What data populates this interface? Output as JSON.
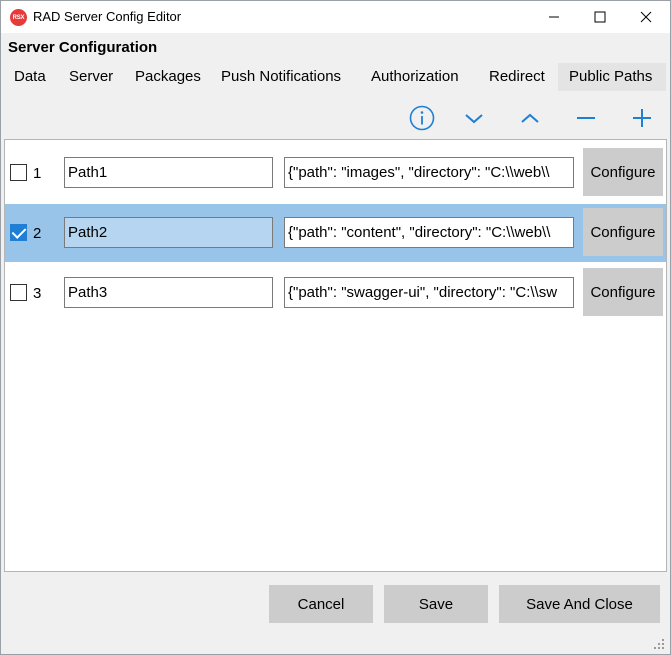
{
  "window": {
    "title": "RAD Server Config Editor",
    "icon_label": "RSX"
  },
  "section_title": "Server Configuration",
  "tabs": [
    {
      "label": "Data",
      "active": false
    },
    {
      "label": "Server",
      "active": false
    },
    {
      "label": "Packages",
      "active": false
    },
    {
      "label": "Push Notifications",
      "active": false
    },
    {
      "label": "Authorization",
      "active": false
    },
    {
      "label": "Redirect",
      "active": false
    },
    {
      "label": "Public Paths",
      "active": true
    }
  ],
  "toolbar": {
    "icons": [
      "info-icon",
      "move-down-icon",
      "move-up-icon",
      "remove-icon",
      "add-icon"
    ],
    "accent_color": "#1f7fd4"
  },
  "rows": [
    {
      "checked": false,
      "number": "1",
      "name": "Path1",
      "json": "{\"path\": \"images\", \"directory\": \"C:\\\\web\\\\",
      "button": "Configure",
      "selected": false
    },
    {
      "checked": true,
      "number": "2",
      "name": "Path2",
      "json": "{\"path\": \"content\", \"directory\": \"C:\\\\web\\\\",
      "button": "Configure",
      "selected": true
    },
    {
      "checked": false,
      "number": "3",
      "name": "Path3",
      "json": "{\"path\": \"swagger-ui\", \"directory\": \"C:\\\\sw",
      "button": "Configure",
      "selected": false
    }
  ],
  "buttons": {
    "cancel": "Cancel",
    "save": "Save",
    "save_and_close": "Save And Close"
  },
  "colors": {
    "selection": "#99c4ea",
    "button_bg": "#cccccc"
  }
}
